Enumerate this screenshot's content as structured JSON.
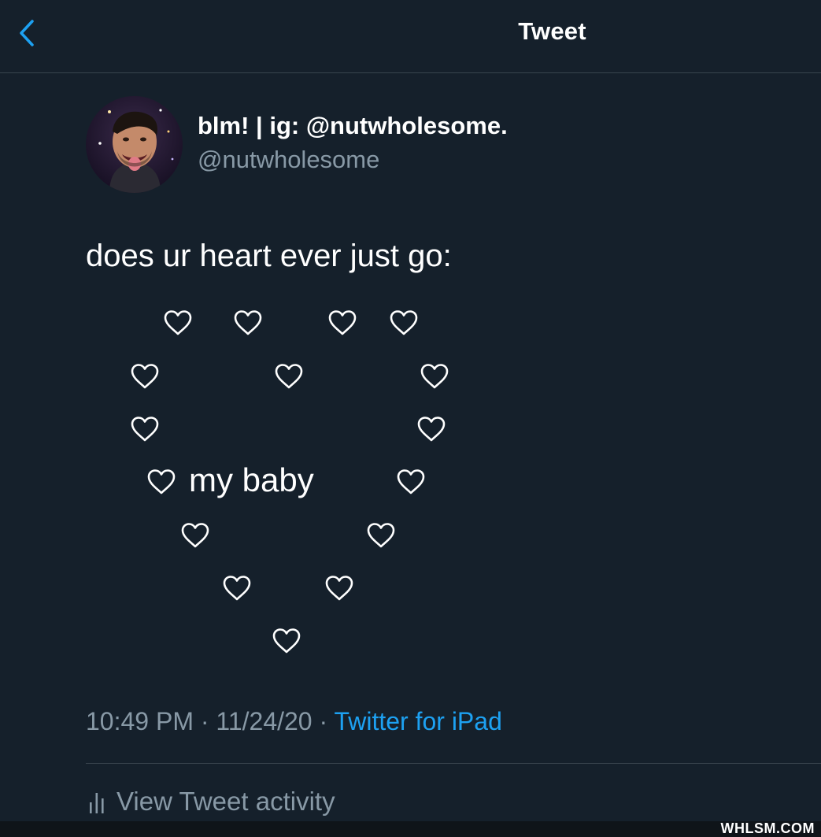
{
  "header": {
    "title": "Tweet",
    "back_icon": "chevron-left-icon"
  },
  "author": {
    "display_name": "blm! | ig: @nutwholesome.",
    "handle": "@nutwholesome"
  },
  "tweet": {
    "text": "does ur heart ever just go:",
    "center_text": "my baby",
    "heart_icon": "heart-outline-icon"
  },
  "meta": {
    "time": "10:49 PM",
    "separator": "·",
    "date": "11/24/20",
    "source": "Twitter for iPad"
  },
  "activity": {
    "label": "View Tweet activity",
    "icon": "bar-chart-icon"
  },
  "watermark": "WHLSM.COM",
  "colors": {
    "background": "#15202b",
    "secondary_text": "#8899a6",
    "accent": "#1da1f2",
    "divider": "#38444d"
  }
}
